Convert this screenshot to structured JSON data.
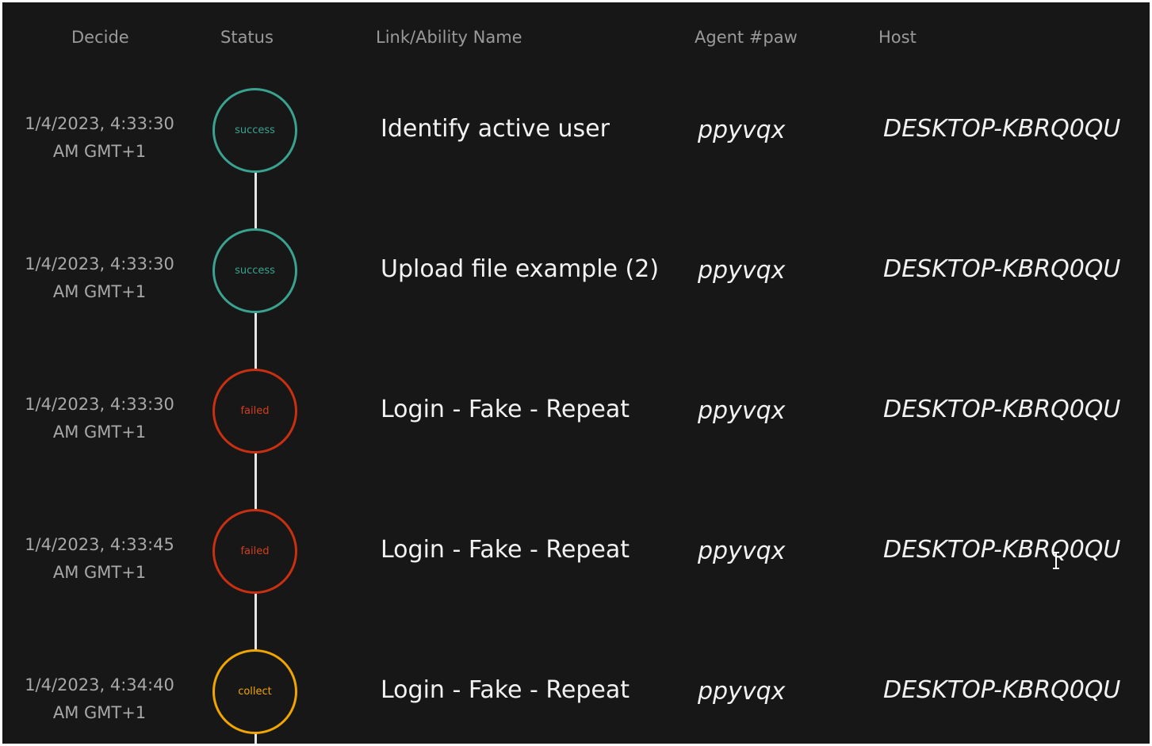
{
  "headers": {
    "decide": "Decide",
    "status": "Status",
    "link": "Link/Ability Name",
    "agent": "Agent #paw",
    "host": "Host"
  },
  "rows": [
    {
      "date_line1": "1/4/2023, 4:33:30",
      "date_line2": "AM GMT+1",
      "status": "success",
      "link": "Identify active user",
      "agent": "ppyvqx",
      "host": "DESKTOP-KBRQ0QU"
    },
    {
      "date_line1": "1/4/2023, 4:33:30",
      "date_line2": "AM GMT+1",
      "status": "success",
      "link": "Upload file example (2)",
      "agent": "ppyvqx",
      "host": "DESKTOP-KBRQ0QU"
    },
    {
      "date_line1": "1/4/2023, 4:33:30",
      "date_line2": "AM GMT+1",
      "status": "failed",
      "link": "Login - Fake - Repeat",
      "agent": "ppyvqx",
      "host": "DESKTOP-KBRQ0QU"
    },
    {
      "date_line1": "1/4/2023, 4:33:45",
      "date_line2": "AM GMT+1",
      "status": "failed",
      "link": "Login - Fake - Repeat",
      "agent": "ppyvqx",
      "host": "DESKTOP-KBRQ0QU"
    },
    {
      "date_line1": "1/4/2023, 4:34:40",
      "date_line2": "AM GMT+1",
      "status": "collect",
      "link": "Login - Fake - Repeat",
      "agent": "ppyvqx",
      "host": "DESKTOP-KBRQ0QU"
    }
  ],
  "colors": {
    "background": "#171717",
    "success": "#3aa28f",
    "failed": "#c93012",
    "collect": "#f0a500",
    "text": "#f2f2f2",
    "muted": "#9a9a9a"
  }
}
